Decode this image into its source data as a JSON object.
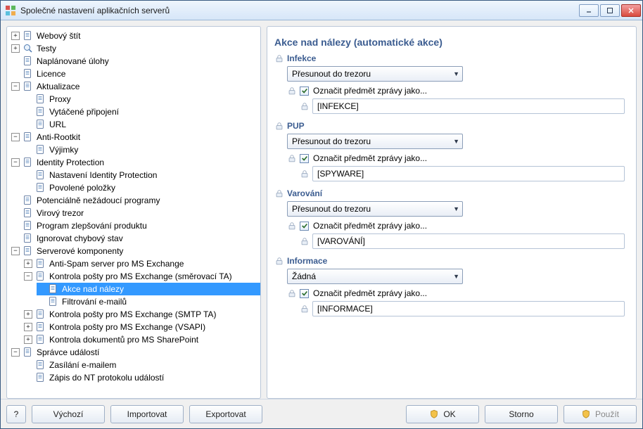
{
  "window": {
    "title": "Společné nastavení aplikačních serverů"
  },
  "tree": {
    "items": [
      "Webový štít",
      "Testy",
      "Naplánované úlohy",
      "Licence",
      "Aktualizace",
      "Proxy",
      "Vytáčené připojení",
      "URL",
      "Anti-Rootkit",
      "Výjimky",
      "Identity Protection",
      "Nastavení Identity Protection",
      "Povolené položky",
      "Potenciálně nežádoucí programy",
      "Virový trezor",
      "Program zlepšování produktu",
      "Ignorovat chybový stav",
      "Serverové komponenty",
      "Anti-Spam server pro MS Exchange",
      "Kontrola pošty pro MS Exchange (směrovací TA)",
      "Akce nad nálezy",
      "Filtrování e-mailů",
      "Kontrola pošty pro MS Exchange (SMTP TA)",
      "Kontrola pošty pro MS Exchange (VSAPI)",
      "Kontrola dokumentů pro MS SharePoint",
      "Správce událostí",
      "Zasílání e-mailem",
      "Zápis do NT protokolu událostí"
    ]
  },
  "main": {
    "heading": "Akce nad nálezy (automatické akce)",
    "checkbox_label": "Označit předmět zprávy jako...",
    "dropdown_move": "Přesunout do trezoru",
    "dropdown_none": "Žádná",
    "sections": {
      "infekce": {
        "title": "Infekce",
        "value": "[INFEKCE]"
      },
      "pup": {
        "title": "PUP",
        "value": "[SPYWARE]"
      },
      "varovani": {
        "title": "Varování",
        "value": "[VAROVÁNÍ]"
      },
      "informace": {
        "title": "Informace",
        "value": "[INFORMACE]"
      }
    }
  },
  "footer": {
    "help": "?",
    "default": "Výchozí",
    "import": "Importovat",
    "export": "Exportovat",
    "ok": "OK",
    "cancel": "Storno",
    "apply": "Použít"
  }
}
